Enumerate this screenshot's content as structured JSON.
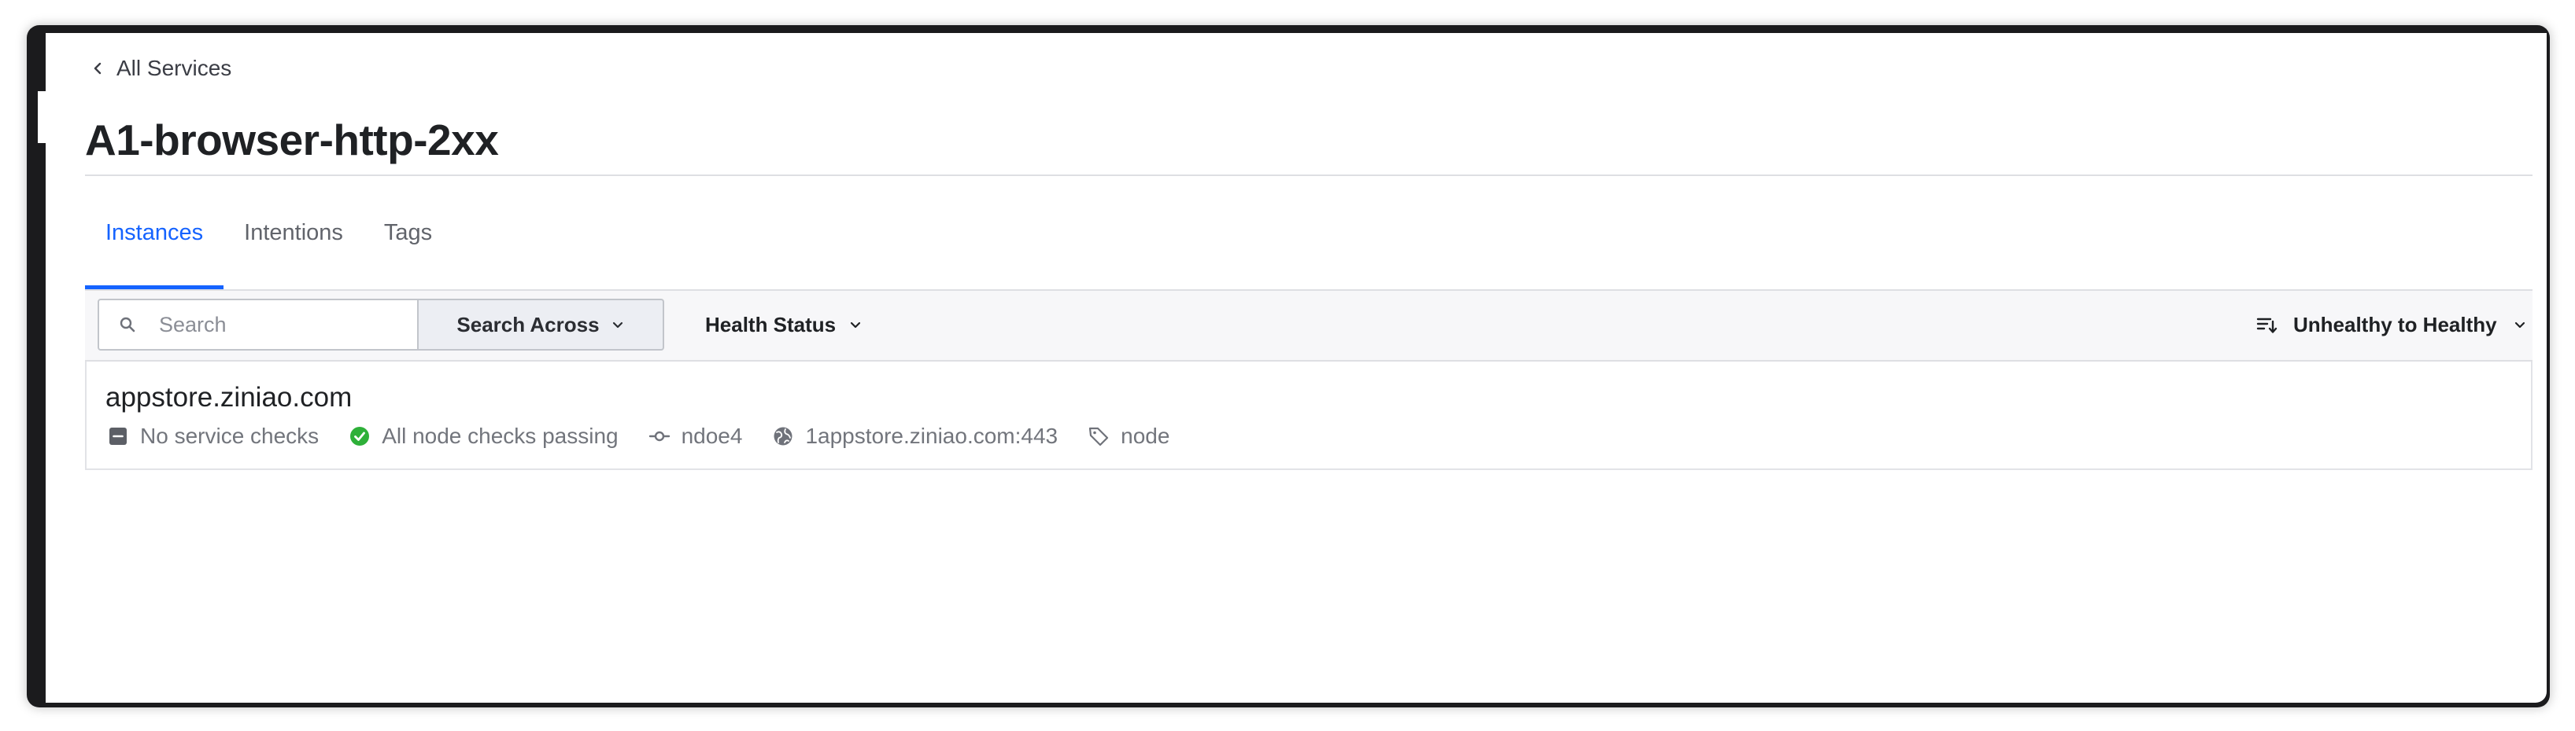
{
  "nav": {
    "back_label": "All Services"
  },
  "page": {
    "title": "A1-browser-http-2xx"
  },
  "tabs": [
    {
      "label": "Instances",
      "active": true
    },
    {
      "label": "Intentions",
      "active": false
    },
    {
      "label": "Tags",
      "active": false
    }
  ],
  "toolbar": {
    "search_placeholder": "Search",
    "search_value": "",
    "search_across_label": "Search Across",
    "health_status_label": "Health Status",
    "sort_label": "Unhealthy to Healthy"
  },
  "instances": [
    {
      "name": "appstore.ziniao.com",
      "service_checks": "No service checks",
      "node_checks": "All node checks passing",
      "node": "ndoe4",
      "address": "1appstore.ziniao.com:443",
      "tag": "node"
    }
  ],
  "colors": {
    "accent": "#1563ff",
    "passing": "#2eb039",
    "muted_text": "#72757c",
    "title_text": "#1f2124",
    "window_frame": "#1b1b1d"
  },
  "icons": {
    "back": "chevron-left-icon",
    "search": "search-icon",
    "dropdown": "chevron-down-icon",
    "sort": "sort-icon",
    "no_checks": "minus-square-icon",
    "passing": "check-circle-icon",
    "node": "git-commit-icon",
    "address": "globe-icon",
    "tag": "tag-icon"
  }
}
